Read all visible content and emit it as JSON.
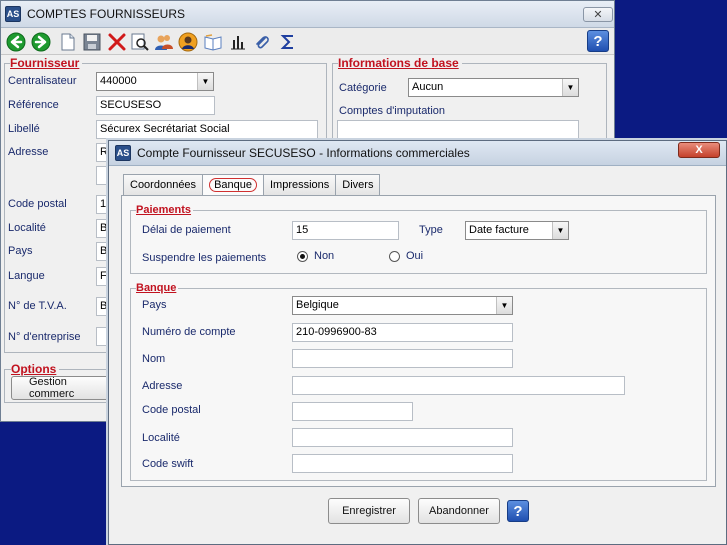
{
  "back_window": {
    "title": "COMPTES FOURNISSEURS",
    "close_glyph": "✕",
    "help_glyph": "?",
    "fournisseur_section": {
      "title": "Fournisseur",
      "centralisateur_label": "Centralisateur",
      "centralisateur_value": "440000",
      "reference_label": "Référence",
      "reference_value": "SECUSESO",
      "libelle_label": "Libellé",
      "libelle_value": "Sécurex Secrétariat Social",
      "adresse_label": "Adresse",
      "adresse_value_partial": "R",
      "code_postal_label": "Code postal",
      "code_postal_partial": "1",
      "localite_label": "Localité",
      "localite_partial": "B",
      "pays_label": "Pays",
      "pays_partial": "B",
      "langue_label": "Langue",
      "langue_partial": "F",
      "tva_label": "N° de T.V.A.",
      "tva_partial": "B",
      "entreprise_label": "N° d'entreprise"
    },
    "info_section": {
      "title": "Informations de base",
      "categorie_label": "Catégorie",
      "categorie_value": "Aucun",
      "comptes_label": "Comptes d'imputation"
    },
    "options_section": {
      "title": "Options",
      "gestion_button": "Gestion commerc"
    }
  },
  "dialog": {
    "title": "Compte Fournisseur  SECUSESO - Informations commerciales",
    "close_glyph": "X",
    "tabs": [
      "Coordonnées",
      "Banque",
      "Impressions",
      "Divers"
    ],
    "active_tab": "Banque",
    "paiements": {
      "title": "Paiements",
      "delai_label": "Délai de paiement",
      "delai_value": "15",
      "type_label": "Type",
      "type_value": "Date facture",
      "suspendre_label": "Suspendre les paiements",
      "non_label": "Non",
      "oui_label": "Oui",
      "selected": "Non"
    },
    "banque": {
      "title": "Banque",
      "pays_label": "Pays",
      "pays_value": "Belgique",
      "numero_label": "Numéro de compte",
      "numero_value": "210-0996900-83",
      "nom_label": "Nom",
      "nom_value": "",
      "adresse_label": "Adresse",
      "adresse_value": "",
      "code_postal_label": "Code postal",
      "code_postal_value": "",
      "localite_label": "Localité",
      "localite_value": "",
      "swift_label": "Code swift",
      "swift_value": ""
    },
    "buttons": {
      "save": "Enregistrer",
      "cancel": "Abandonner",
      "help": "?"
    }
  }
}
